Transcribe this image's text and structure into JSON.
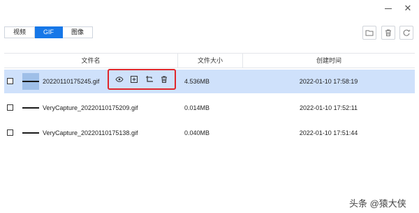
{
  "window": {
    "minimize_icon": "minimize-icon",
    "close_symbol": "✕"
  },
  "tabs": [
    {
      "label": "视频",
      "active": false
    },
    {
      "label": "GIF",
      "active": true
    },
    {
      "label": "图像",
      "active": false
    }
  ],
  "toolbar": {
    "icons": [
      "folder-icon",
      "trash-icon",
      "refresh-icon"
    ]
  },
  "table": {
    "headers": {
      "name": "文件名",
      "size": "文件大小",
      "time": "创建时间"
    },
    "rows": [
      {
        "name": "20220110175245.gif",
        "size": "4.536MB",
        "time": "2022-01-10 17:58:19",
        "selected": true
      },
      {
        "name": "VeryCapture_20220110175209.gif",
        "size": "0.014MB",
        "time": "2022-01-10 17:52:11",
        "selected": false
      },
      {
        "name": "VeryCapture_20220110175138.gif",
        "size": "0.040MB",
        "time": "2022-01-10 17:51:44",
        "selected": false
      }
    ],
    "row_actions": [
      "eye-icon",
      "add-frame-icon",
      "crop-icon",
      "trash-icon"
    ]
  },
  "watermark": "头条 @猿大侠",
  "colors": {
    "accent": "#1677e8",
    "selected_row": "#cfe1fb",
    "highlight_border": "#e0262b"
  }
}
